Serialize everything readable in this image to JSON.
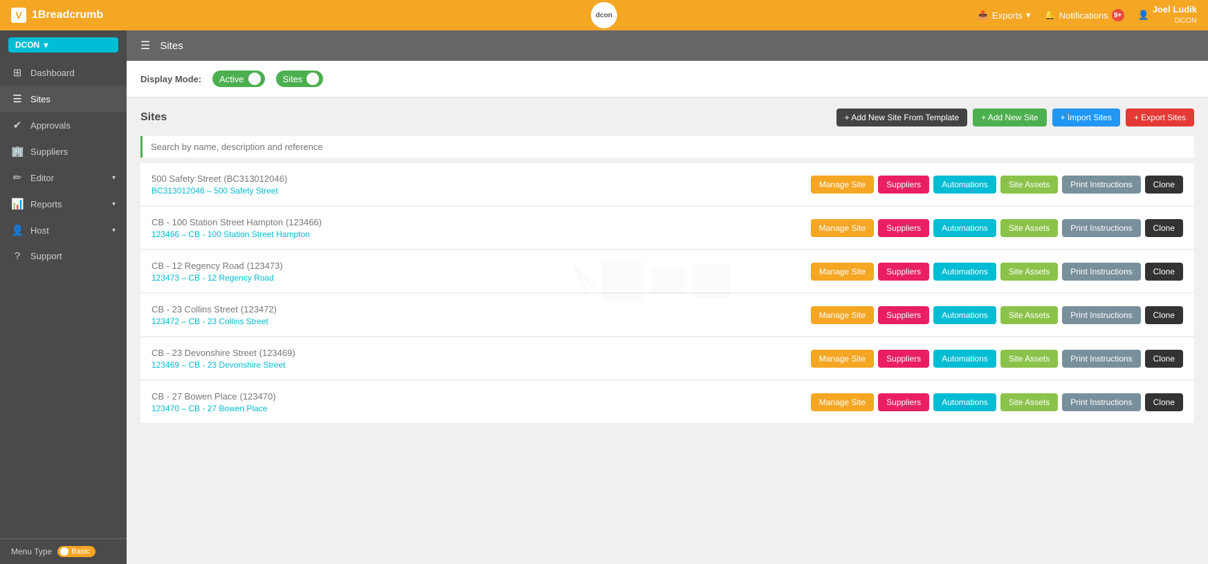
{
  "topNav": {
    "brand": "1Breadcrumb",
    "logoText": "V",
    "centerLogo": "dcon",
    "exports": "Exports",
    "notifications": "Notifications",
    "notifCount": "9+",
    "userName": "Joel Ludik",
    "userSub": "DCON"
  },
  "sidebar": {
    "dconTag": "DCON",
    "items": [
      {
        "id": "dashboard",
        "label": "Dashboard",
        "icon": "⊞",
        "hasArrow": false
      },
      {
        "id": "sites",
        "label": "Sites",
        "icon": "☰",
        "hasArrow": false,
        "active": true
      },
      {
        "id": "approvals",
        "label": "Approvals",
        "icon": "✔",
        "hasArrow": false
      },
      {
        "id": "suppliers",
        "label": "Suppliers",
        "icon": "🏢",
        "hasArrow": false
      },
      {
        "id": "editor",
        "label": "Editor",
        "icon": "✏",
        "hasArrow": true
      },
      {
        "id": "reports",
        "label": "Reports",
        "icon": "📊",
        "hasArrow": true
      },
      {
        "id": "host",
        "label": "Host",
        "icon": "👤",
        "hasArrow": true
      },
      {
        "id": "support",
        "label": "Support",
        "icon": "?",
        "hasArrow": false
      }
    ],
    "menuTypeLabel": "Menu Type",
    "menuTypeValue": "Basic"
  },
  "headerBar": {
    "title": "Sites"
  },
  "displayMode": {
    "label": "Display Mode:",
    "toggle1Label": "Active",
    "toggle2Label": "Sites"
  },
  "sitesSection": {
    "title": "Sites",
    "actions": {
      "addFromTemplate": "+ Add New Site From Template",
      "addNew": "+ Add New Site",
      "import": "+ Import Sites",
      "export": "+ Export Sites"
    },
    "searchPlaceholder": "Search by name, description and reference"
  },
  "sites": [
    {
      "name": "500 Safety Street",
      "code": "BC313012046",
      "ref": "BC313012046 – 500 Safety Street"
    },
    {
      "name": "CB - 100 Station Street Hampton",
      "code": "123466",
      "ref": "123466 – CB - 100 Station Street Hampton"
    },
    {
      "name": "CB - 12 Regency Road",
      "code": "123473",
      "ref": "123473 – CB - 12 Regency Road"
    },
    {
      "name": "CB - 23 Collins Street",
      "code": "123472",
      "ref": "123472 – CB - 23 Collins Street"
    },
    {
      "name": "CB - 23 Devonshire Street",
      "code": "123469",
      "ref": "123469 – CB - 23 Devonshire Street"
    },
    {
      "name": "CB - 27 Bowen Place",
      "code": "123470",
      "ref": "123470 – CB - 27 Bowen Place"
    }
  ],
  "siteButtons": {
    "manageSite": "Manage Site",
    "suppliers": "Suppliers",
    "automations": "Automations",
    "siteAssets": "Site Assets",
    "printInstructions": "Print Instructions",
    "clone": "Clone"
  },
  "colors": {
    "orange": "#f5a623",
    "green": "#4caf50",
    "blue": "#2196f3",
    "red": "#e53935",
    "teal": "#00bcd4",
    "pink": "#e91e63",
    "lime": "#8bc34a",
    "dark": "#333"
  }
}
